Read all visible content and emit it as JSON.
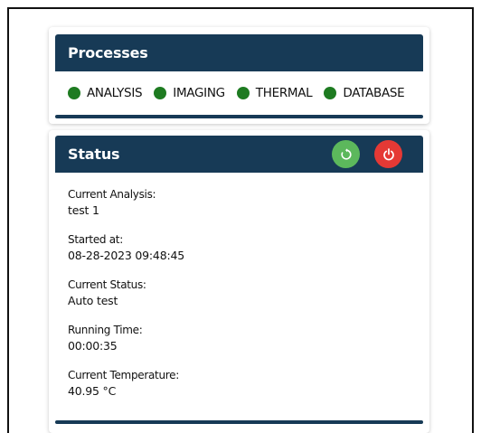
{
  "processes": {
    "title": "Processes",
    "items": [
      {
        "label": "ANALYSIS",
        "color": "#1e7b21"
      },
      {
        "label": "IMAGING",
        "color": "#1e7b21"
      },
      {
        "label": "THERMAL",
        "color": "#1e7b21"
      },
      {
        "label": "DATABASE",
        "color": "#1e7b21"
      }
    ]
  },
  "status": {
    "title": "Status",
    "restart_icon": "restart-icon",
    "power_icon": "power-icon",
    "fields": [
      {
        "label": "Current Analysis:",
        "value": "test 1"
      },
      {
        "label": "Started at:",
        "value": "08-28-2023 09:48:45"
      },
      {
        "label": "Current Status:",
        "value": "Auto test"
      },
      {
        "label": "Running Time:",
        "value": "00:00:35"
      },
      {
        "label": "Current Temperature:",
        "value": "40.95 °C"
      }
    ]
  },
  "colors": {
    "header": "#173a56",
    "status_ok": "#1e7b21",
    "restart_button": "#5cb85c",
    "power_button": "#e53935"
  }
}
